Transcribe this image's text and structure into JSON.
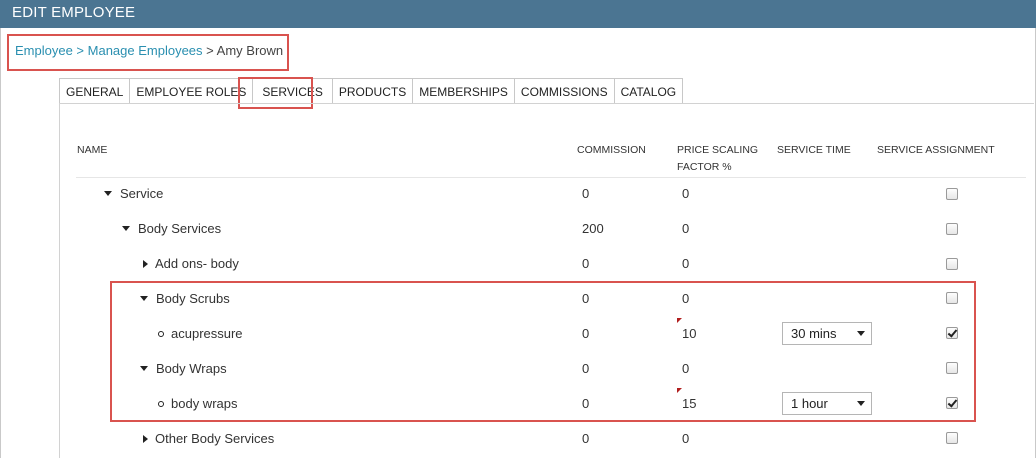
{
  "window": {
    "title": "EDIT EMPLOYEE"
  },
  "breadcrumb": {
    "level1": "Employee",
    "sep1": " > ",
    "level2": "Manage Employees",
    "sep2": " > ",
    "current": "Amy Brown"
  },
  "tabs": [
    "GENERAL",
    "EMPLOYEE ROLES",
    "SERVICES",
    "PRODUCTS",
    "MEMBERSHIPS",
    "COMMISSIONS",
    "CATALOG"
  ],
  "active_tab": "SERVICES",
  "columns": {
    "name": "NAME",
    "commission": "COMMISSION",
    "price_scaling_1": "PRICE SCALING",
    "price_scaling_2": "FACTOR %",
    "service_time": "SERVICE TIME",
    "service_assignment": "SERVICE ASSIGNMENT"
  },
  "rows": [
    {
      "label": "Service",
      "icon": "caret-down-icon",
      "commission": "0",
      "price_factor": "0",
      "service_time": "",
      "assigned": false
    },
    {
      "label": "Body Services",
      "icon": "caret-down-icon",
      "commission": "200",
      "price_factor": "0",
      "service_time": "",
      "assigned": false
    },
    {
      "label": "Add ons- body",
      "icon": "caret-right-icon",
      "commission": "0",
      "price_factor": "0",
      "service_time": "",
      "assigned": false
    },
    {
      "label": "Body Scrubs",
      "icon": "caret-down-icon",
      "commission": "0",
      "price_factor": "0",
      "service_time": "",
      "assigned": false
    },
    {
      "label": "acupressure",
      "icon": "bullet-icon",
      "commission": "0",
      "price_factor": "10",
      "service_time": "30 mins",
      "assigned": true
    },
    {
      "label": "Body Wraps",
      "icon": "caret-down-icon",
      "commission": "0",
      "price_factor": "0",
      "service_time": "",
      "assigned": false
    },
    {
      "label": "body wraps",
      "icon": "bullet-icon",
      "commission": "0",
      "price_factor": "15",
      "service_time": "1 hour",
      "assigned": true
    },
    {
      "label": "Other Body Services",
      "icon": "caret-right-icon",
      "commission": "0",
      "price_factor": "0",
      "service_time": "",
      "assigned": false
    }
  ],
  "colors": {
    "titlebar": "#4b7592",
    "link": "#2a8fb0",
    "highlight": "#d9534f"
  }
}
